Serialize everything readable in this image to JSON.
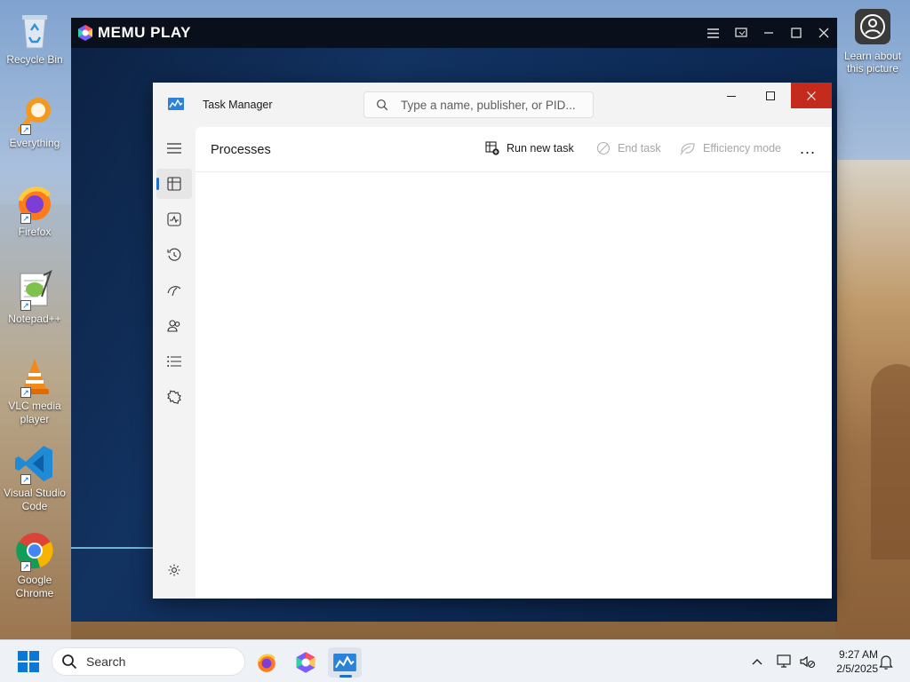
{
  "desktop": {
    "icons": [
      {
        "label": "Recycle Bin",
        "icon": "recycle-bin-icon"
      },
      {
        "label": "Everything",
        "icon": "everything-search-icon"
      },
      {
        "label": "Firefox",
        "icon": "firefox-icon"
      },
      {
        "label": "Notepad++",
        "icon": "notepad-plus-plus-icon"
      },
      {
        "label": "VLC media player",
        "icon": "vlc-icon"
      },
      {
        "label": "Visual Studio Code",
        "icon": "vscode-icon"
      },
      {
        "label": "Google Chrome",
        "icon": "chrome-icon"
      }
    ],
    "learn_about": {
      "label": "Learn about this picture",
      "icon": "camera-icon"
    }
  },
  "memu": {
    "title": "MEMU PLAY",
    "controls": [
      "menu-icon",
      "screen-record-icon",
      "minimize-icon",
      "maximize-icon",
      "close-icon"
    ]
  },
  "task_manager": {
    "title": "Task Manager",
    "search_placeholder": "Type a name, publisher, or PID...",
    "page_heading": "Processes",
    "toolbar": {
      "run_new_task": "Run new task",
      "end_task": "End task",
      "efficiency_mode": "Efficiency mode",
      "more": "..."
    },
    "nav": [
      {
        "name": "processes",
        "icon": "processes-icon",
        "active": true
      },
      {
        "name": "performance",
        "icon": "performance-icon",
        "active": false
      },
      {
        "name": "app-history",
        "icon": "history-icon",
        "active": false
      },
      {
        "name": "startup-apps",
        "icon": "startup-icon",
        "active": false
      },
      {
        "name": "users",
        "icon": "users-icon",
        "active": false
      },
      {
        "name": "details",
        "icon": "details-icon",
        "active": false
      },
      {
        "name": "services",
        "icon": "services-icon",
        "active": false
      },
      {
        "name": "settings",
        "icon": "settings-icon",
        "active": false
      }
    ],
    "accent": "#1f6fc5",
    "close_color": "#c42b1c"
  },
  "taskbar": {
    "search_label": "Search",
    "pinned": [
      "firefox-icon",
      "memu-icon",
      "task-manager-icon"
    ],
    "time": "9:27 AM",
    "date": "2/5/2025"
  }
}
